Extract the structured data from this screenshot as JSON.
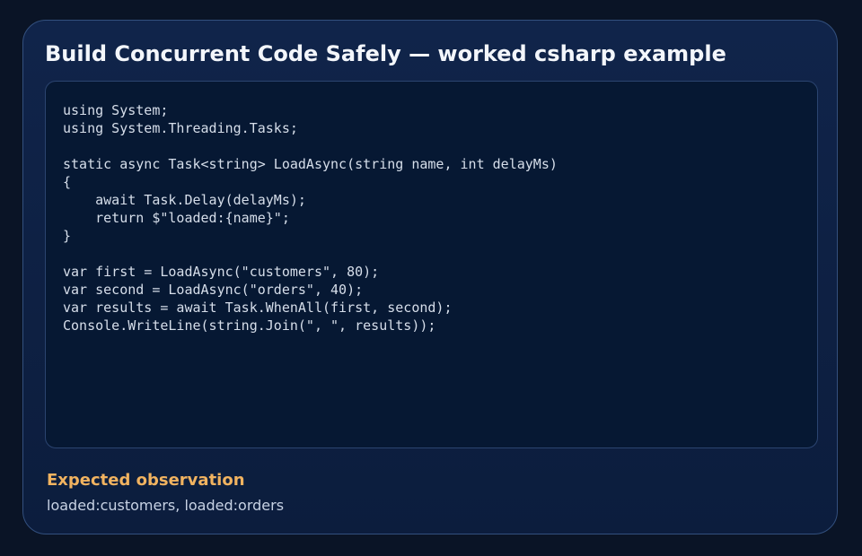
{
  "card": {
    "title": "Build Concurrent Code Safely — worked csharp example"
  },
  "code": {
    "language": "csharp",
    "lines": [
      "using System;",
      "using System.Threading.Tasks;",
      "",
      "static async Task<string> LoadAsync(string name, int delayMs)",
      "{",
      "    await Task.Delay(delayMs);",
      "    return $\"loaded:{name}\";",
      "}",
      "",
      "var first = LoadAsync(\"customers\", 80);",
      "var second = LoadAsync(\"orders\", 40);",
      "var results = await Task.WhenAll(first, second);",
      "Console.WriteLine(string.Join(\", \", results));"
    ]
  },
  "observation": {
    "label": "Expected observation",
    "value": "loaded:customers, loaded:orders"
  },
  "colors": {
    "background": "#0a1426",
    "card": "#10244a",
    "code_panel": "#061833",
    "accent": "#f1b360"
  }
}
